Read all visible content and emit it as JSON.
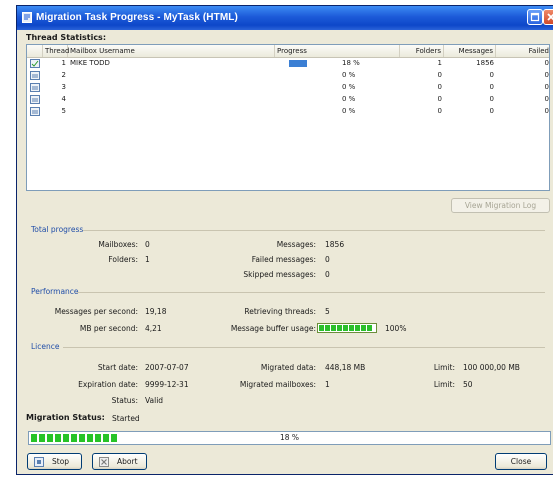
{
  "window": {
    "title": "Migration Task Progress - MyTask (HTML)",
    "buttons": [
      "maximize",
      "close"
    ]
  },
  "thread_statistics": {
    "title": "Thread Statistics:",
    "columns": [
      "Thread",
      "Mailbox Username",
      "Progress",
      "Folders",
      "Messages",
      "Failed"
    ],
    "rows": [
      {
        "thread": "1",
        "mailbox": "MIKE TODD",
        "progress": "18 %",
        "progress_fraction": 0.18,
        "folders": "1",
        "messages": "1856",
        "failed": "0"
      },
      {
        "thread": "2",
        "mailbox": "",
        "progress": "0 %",
        "progress_fraction": 0,
        "folders": "0",
        "messages": "0",
        "failed": "0"
      },
      {
        "thread": "3",
        "mailbox": "",
        "progress": "0 %",
        "progress_fraction": 0,
        "folders": "0",
        "messages": "0",
        "failed": "0"
      },
      {
        "thread": "4",
        "mailbox": "",
        "progress": "0 %",
        "progress_fraction": 0,
        "folders": "0",
        "messages": "0",
        "failed": "0"
      },
      {
        "thread": "5",
        "mailbox": "",
        "progress": "0 %",
        "progress_fraction": 0,
        "folders": "0",
        "messages": "0",
        "failed": "0"
      }
    ],
    "view_log_label": "View Migration Log"
  },
  "total_progress": {
    "title": "Total progress",
    "mailboxes_label": "Mailboxes:",
    "mailboxes": "0",
    "folders_label": "Folders:",
    "folders": "1",
    "messages_label": "Messages:",
    "messages": "1856",
    "failed_label": "Failed messages:",
    "failed": "0",
    "skipped_label": "Skipped messages:",
    "skipped": "0"
  },
  "performance": {
    "title": "Performance",
    "mps_label": "Messages per second:",
    "mps": "19,18",
    "mbps_label": "MB per second:",
    "mbps": "4,21",
    "threads_label": "Retrieving threads:",
    "threads": "5",
    "buffer_label": "Message buffer usage:",
    "buffer": "100%",
    "buffer_fraction": 1.0
  },
  "licence": {
    "title": "Licence",
    "start_label": "Start date:",
    "start": "2007-07-07",
    "expiration_label": "Expiration date:",
    "expiration": "9999-12-31",
    "status_label": "Status:",
    "status": "Valid",
    "migrated_data_label": "Migrated data:",
    "migrated_data": "448,18 MB",
    "migrated_mailboxes_label": "Migrated mailboxes:",
    "migrated_mailboxes": "1",
    "limit_data_label": "Limit:",
    "limit_data": "100 000,00 MB",
    "limit_mailboxes_label": "Limit:",
    "limit_mailboxes": "50"
  },
  "migration_status": {
    "label": "Migration Status:",
    "value": "Started",
    "progress": "18 %",
    "progress_fraction": 0.18
  },
  "buttons": {
    "stop": "Stop",
    "abort": "Abort",
    "close": "Close"
  },
  "colors": {
    "titlebar": "#0d47c9",
    "section_heading": "#214ea8",
    "progress_fill": "#27c327",
    "row_progress": "#3b7fd4"
  }
}
